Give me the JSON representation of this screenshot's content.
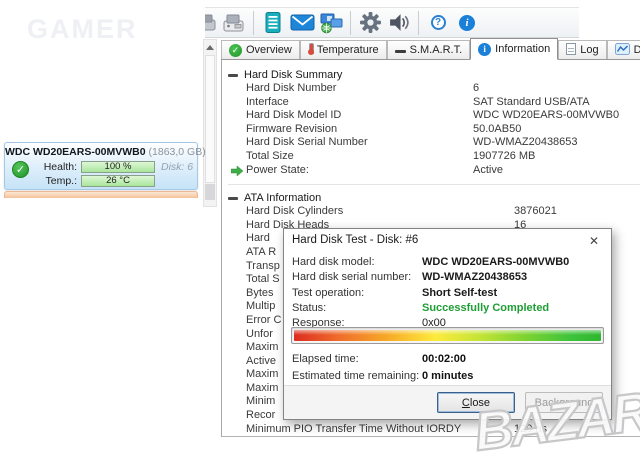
{
  "watermarks": {
    "top_left": "GAMER",
    "bottom_right": "BAZAR"
  },
  "toolbar": {
    "icons": [
      "device-partial-icon",
      "drive-icon",
      "separator",
      "report-icon",
      "mail-icon",
      "network-icon",
      "separator",
      "settings-gear-icon",
      "sound-icon",
      "separator",
      "help-icon",
      "info-icon"
    ]
  },
  "tabbar": {
    "scroll_up_icon": "chevron-up-icon",
    "tabs": [
      {
        "label": "Overview",
        "icon": "check-circle-icon",
        "active": false
      },
      {
        "label": "Temperature",
        "icon": "thermometer-icon",
        "active": false
      },
      {
        "label": "S.M.A.R.T.",
        "icon": "dash-icon",
        "active": false
      },
      {
        "label": "Information",
        "icon": "info-circle-icon",
        "active": true
      },
      {
        "label": "Log",
        "icon": "document-icon",
        "active": false
      },
      {
        "label": "Disk Performance",
        "icon": "chart-icon",
        "active": false
      }
    ]
  },
  "disk_card": {
    "model": "WDC WD20EARS-00MVWB0",
    "size": "(1863,0 GB)",
    "status_icon": "check-circle-icon",
    "health_label": "Health:",
    "health_value": "100 %",
    "disk_note": "Disk: 6",
    "temp_label": "Temp.:",
    "temp_value": "26 °C",
    "colors": {
      "health_bar": "#a9e59b",
      "card_border": "#a5c8e6",
      "status_green": "#2d9e2d",
      "next_item_strip": "#f3c29a"
    }
  },
  "info": {
    "sections": [
      {
        "title": "Hard Disk Summary",
        "rows": [
          {
            "label": "Hard Disk Number",
            "value": "6"
          },
          {
            "label": "Interface",
            "value": "SAT Standard USB/ATA"
          },
          {
            "label": "Hard Disk Model ID",
            "value": "WDC WD20EARS-00MVWB0"
          },
          {
            "label": "Firmware Revision",
            "value": "50.0AB50"
          },
          {
            "label": "Hard Disk Serial Number",
            "value": "WD-WMAZ20438653"
          },
          {
            "label": "Total Size",
            "value": "1907726 MB"
          },
          {
            "label": "Power State:",
            "value": "Active",
            "icon": "power-arrow-icon"
          }
        ]
      },
      {
        "title": "ATA Information",
        "rows": [
          {
            "label": "Hard Disk Cylinders",
            "value": "3876021"
          },
          {
            "label": "Hard Disk Heads",
            "value": "16"
          },
          {
            "label": "Hard",
            "value": ""
          },
          {
            "label": "ATA R",
            "value": ""
          },
          {
            "label": "Transp",
            "value": ""
          },
          {
            "label": "Total S",
            "value": ""
          },
          {
            "label": "Bytes",
            "value": ""
          },
          {
            "label": "Multip",
            "value": ""
          },
          {
            "label": "Error C",
            "value": ""
          },
          {
            "label": "Unfor",
            "value": ""
          },
          {
            "label": "Maxim",
            "value": ""
          },
          {
            "label": "Active",
            "value": ""
          },
          {
            "label": "Maxim",
            "value": ""
          },
          {
            "label": "Maxim",
            "value": ""
          },
          {
            "label": "Minim",
            "value": ""
          },
          {
            "label": "Recor",
            "value": ""
          },
          {
            "label": "Minimum PIO Transfer Time Without IORDY",
            "value": "120 ns"
          }
        ]
      }
    ]
  },
  "dialog": {
    "title": "Hard Disk Test - Disk: #6",
    "close_icon": "close-icon",
    "rows": [
      {
        "label": "Hard disk model:",
        "value": "WDC WD20EARS-00MVWB0",
        "bold": true
      },
      {
        "label": "Hard disk serial number:",
        "value": "WD-WMAZ20438653",
        "bold": true
      },
      {
        "label": "Test operation:",
        "value": "Short Self-test",
        "bold": true
      },
      {
        "label": "Status:",
        "value": "Successfully Completed",
        "bold": true,
        "color": "#1e9e35"
      },
      {
        "label": "Response:",
        "value": "0x00",
        "bold": false
      }
    ],
    "progress": {
      "percent": 100
    },
    "times": [
      {
        "label": "Elapsed time:",
        "value": "00:02:00"
      },
      {
        "label": "Estimated time remaining:",
        "value": "0 minutes"
      }
    ],
    "buttons": [
      {
        "label": "Close",
        "enabled": true,
        "default": true
      },
      {
        "label": "Background",
        "enabled": false,
        "default": false
      }
    ]
  }
}
